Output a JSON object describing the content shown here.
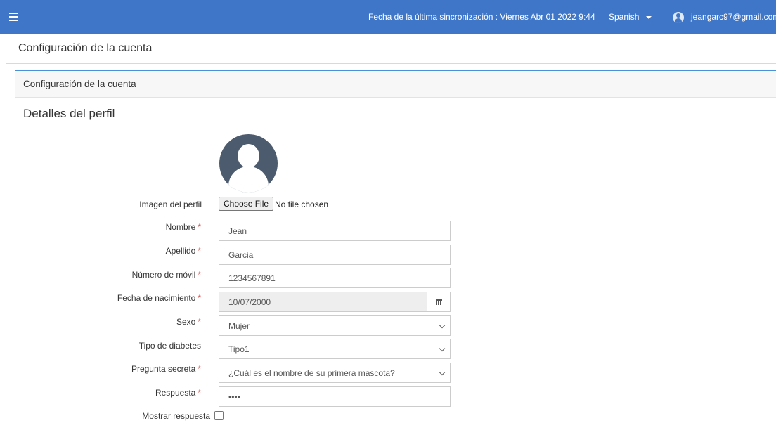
{
  "topbar": {
    "sync_text": "Fecha de la última sincronización : Viernes Abr 01 2022 9:44",
    "language": "Spanish",
    "user_email": "jeangarc97@gmail.com",
    "accent_color": "#3f76c8"
  },
  "page_title": "Configuración de la cuenta",
  "panel": {
    "header": "Configuración de la cuenta",
    "section_title": "Detalles del perfil"
  },
  "form": {
    "profile_image": {
      "label": "Imagen del perfil",
      "button": "Choose File",
      "status": "No file chosen"
    },
    "nombre": {
      "label": "Nombre",
      "required": "*",
      "value": "Jean"
    },
    "apellido": {
      "label": "Apellido",
      "required": "*",
      "value": "Garcia"
    },
    "movil": {
      "label": "Número de móvil",
      "required": "*",
      "value": "1234567891"
    },
    "nacimiento": {
      "label": "Fecha de nacimiento",
      "required": "*",
      "value": "10/07/2000"
    },
    "sexo": {
      "label": "Sexo",
      "required": "*",
      "value": "Mujer"
    },
    "diabetes": {
      "label": "Tipo de diabetes",
      "value": "Tipo1"
    },
    "pregunta": {
      "label": "Pregunta secreta",
      "required": "*",
      "value": "¿Cuál es el nombre de su primera mascota?"
    },
    "respuesta": {
      "label": "Respuesta",
      "required": "*",
      "value": "••••"
    },
    "mostrar": {
      "label": "Mostrar respuesta",
      "checked": false
    }
  },
  "icons": {
    "menu": "hamburger-icon",
    "language": "caret-down-icon",
    "user": "user-avatar-icon",
    "calendar": "calendar-icon",
    "select": "chevron-down-icon"
  }
}
